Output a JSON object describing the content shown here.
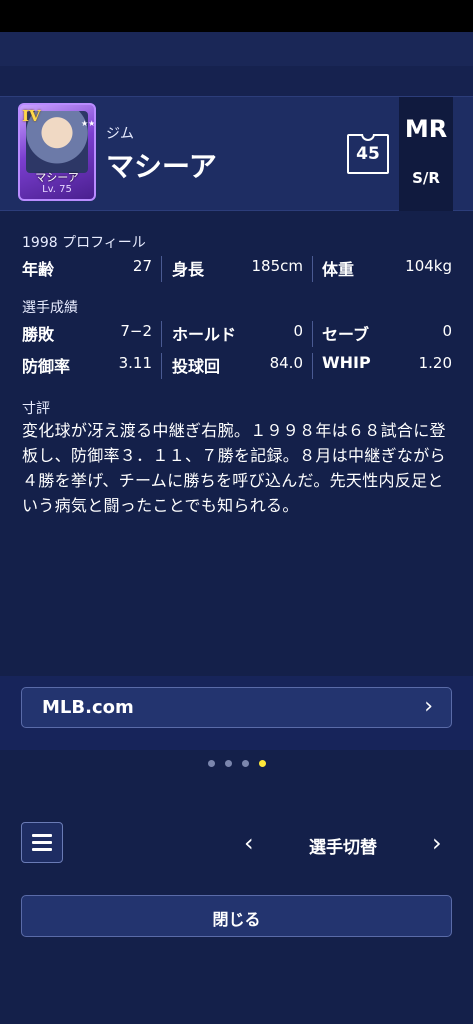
{
  "card": {
    "rank": "IV",
    "stars": "★★★★★",
    "name": "マシーア",
    "level": "Lv. 75"
  },
  "player": {
    "furigana": "ジム",
    "name": "マシーア",
    "uniform_number": "45",
    "position": "MR",
    "handedness": "S/R"
  },
  "profile": {
    "label": "1998 プロフィール",
    "age_label": "年齢",
    "age": "27",
    "height_label": "身長",
    "height": "185cm",
    "weight_label": "体重",
    "weight": "104kg"
  },
  "stats": {
    "label": "選手成績",
    "record_label": "勝敗",
    "record": "7−2",
    "holds_label": "ホールド",
    "holds": "0",
    "saves_label": "セーブ",
    "saves": "0",
    "era_label": "防御率",
    "era": "3.11",
    "ip_label": "投球回",
    "ip": "84.0",
    "whip_label": "WHIP",
    "whip": "1.20"
  },
  "comment": {
    "label": "寸評",
    "text": "変化球が冴え渡る中継ぎ右腕。１９９８年は６８試合に登板し、防御率３．１１、７勝を記録。８月は中継ぎながら４勝を挙げ、チームに勝ちを呼び込んだ。先天性内反足という病気と闘ったことでも知られる。"
  },
  "mlb_link": {
    "label": "MLB.com",
    "chevron": "›"
  },
  "pager": {
    "total": 4,
    "active": 4
  },
  "nav": {
    "prev": "‹",
    "label": "選手切替",
    "next": "›"
  },
  "close": {
    "label": "閉じる"
  },
  "colors": {
    "background": "#14204a",
    "header": "#1e2d63",
    "active_dot": "#ffe83a"
  }
}
